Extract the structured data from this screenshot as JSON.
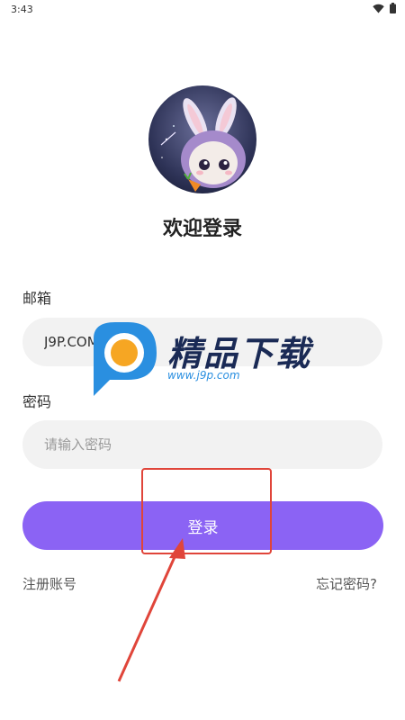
{
  "status_bar": {
    "time": "3:43",
    "wifi_icon": "wifi-icon",
    "battery_icon": "battery-icon"
  },
  "header": {
    "avatar_icon": "bunny-avatar",
    "title": "欢迎登录"
  },
  "form": {
    "email_label": "邮箱",
    "email_value": "J9P.COM",
    "password_label": "密码",
    "password_placeholder": "请输入密码",
    "login_button": "登录"
  },
  "footer": {
    "register_link": "注册账号",
    "forgot_link": "忘记密码?"
  },
  "overlay": {
    "watermark_title": "精品下载",
    "watermark_url": "www.j9p.com",
    "highlight_color": "#e0453a"
  },
  "colors": {
    "accent": "#8b63f4",
    "field_bg": "#f2f2f2"
  }
}
